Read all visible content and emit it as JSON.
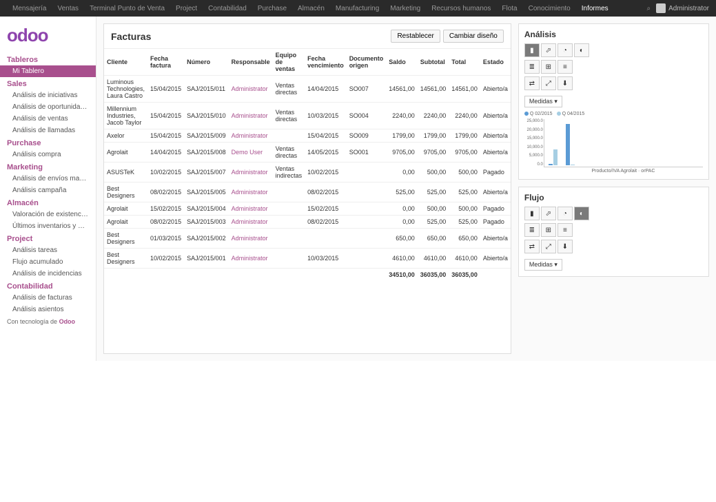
{
  "topnav": {
    "items": [
      "Mensajería",
      "Ventas",
      "Terminal Punto de Venta",
      "Project",
      "Contabilidad",
      "Purchase",
      "Almacén",
      "Manufacturing",
      "Marketing",
      "Recursos humanos",
      "Flota",
      "Conocimiento",
      "Informes"
    ],
    "active_index": 12,
    "search_icon": "⌕",
    "user": "Administrator"
  },
  "logo": "odoo",
  "sidebar": {
    "sections": [
      {
        "title": "Tableros",
        "items": [
          "Mi Tablero"
        ],
        "active_index": 0
      },
      {
        "title": "Sales",
        "items": [
          "Análisis de iniciativas",
          "Análisis de oportunidades",
          "Análisis de ventas",
          "Análisis de llamadas"
        ]
      },
      {
        "title": "Purchase",
        "items": [
          "Análisis compra"
        ]
      },
      {
        "title": "Marketing",
        "items": [
          "Análisis de envíos masivos",
          "Análisis campaña"
        ]
      },
      {
        "title": "Almacén",
        "items": [
          "Valoración de existencias",
          "Últimos inventarios y movi..."
        ]
      },
      {
        "title": "Project",
        "items": [
          "Análisis tareas",
          "Flujo acumulado",
          "Análisis de incidencias"
        ]
      },
      {
        "title": "Contabilidad",
        "items": [
          "Análisis de facturas",
          "Análisis asientos"
        ]
      }
    ]
  },
  "footer_note": {
    "label": "Con tecnología de ",
    "brand": "Odoo"
  },
  "facturas": {
    "title": "Facturas",
    "btn_restablecer": "Restablecer",
    "btn_cambiar": "Cambiar diseño",
    "columns": [
      "Cliente",
      "Fecha factura",
      "Número",
      "Responsable",
      "Equipo de ventas",
      "Fecha vencimiento",
      "Documento origen",
      "Saldo",
      "Subtotal",
      "Total",
      "Estado"
    ],
    "rows": [
      {
        "cliente": "Luminous Technologies, Laura Castro",
        "fecha": "15/04/2015",
        "numero": "SAJ/2015/011",
        "responsable": "Administrator",
        "equipo": "Ventas directas",
        "vencimiento": "14/04/2015",
        "origen": "SO007",
        "saldo": "14561,00",
        "subtotal": "14561,00",
        "total": "14561,00",
        "estado": "Abierto/a"
      },
      {
        "cliente": "Millennium Industries, Jacob Taylor",
        "fecha": "15/04/2015",
        "numero": "SAJ/2015/010",
        "responsable": "Administrator",
        "equipo": "Ventas directas",
        "vencimiento": "10/03/2015",
        "origen": "SO004",
        "saldo": "2240,00",
        "subtotal": "2240,00",
        "total": "2240,00",
        "estado": "Abierto/a"
      },
      {
        "cliente": "Axelor",
        "fecha": "15/04/2015",
        "numero": "SAJ/2015/009",
        "responsable": "Administrator",
        "equipo": "",
        "vencimiento": "15/04/2015",
        "origen": "SO009",
        "saldo": "1799,00",
        "subtotal": "1799,00",
        "total": "1799,00",
        "estado": "Abierto/a"
      },
      {
        "cliente": "Agrolait",
        "fecha": "14/04/2015",
        "numero": "SAJ/2015/008",
        "responsable": "Demo User",
        "equipo": "Ventas directas",
        "vencimiento": "14/05/2015",
        "origen": "SO001",
        "saldo": "9705,00",
        "subtotal": "9705,00",
        "total": "9705,00",
        "estado": "Abierto/a"
      },
      {
        "cliente": "ASUSTeK",
        "fecha": "10/02/2015",
        "numero": "SAJ/2015/007",
        "responsable": "Administrator",
        "equipo": "Ventas indirectas",
        "vencimiento": "10/02/2015",
        "origen": "",
        "saldo": "0,00",
        "subtotal": "500,00",
        "total": "500,00",
        "estado": "Pagado"
      },
      {
        "cliente": "Best Designers",
        "fecha": "08/02/2015",
        "numero": "SAJ/2015/005",
        "responsable": "Administrator",
        "equipo": "",
        "vencimiento": "08/02/2015",
        "origen": "",
        "saldo": "525,00",
        "subtotal": "525,00",
        "total": "525,00",
        "estado": "Abierto/a"
      },
      {
        "cliente": "Agrolait",
        "fecha": "15/02/2015",
        "numero": "SAJ/2015/004",
        "responsable": "Administrator",
        "equipo": "",
        "vencimiento": "15/02/2015",
        "origen": "",
        "saldo": "0,00",
        "subtotal": "500,00",
        "total": "500,00",
        "estado": "Pagado"
      },
      {
        "cliente": "Agrolait",
        "fecha": "08/02/2015",
        "numero": "SAJ/2015/003",
        "responsable": "Administrator",
        "equipo": "",
        "vencimiento": "08/02/2015",
        "origen": "",
        "saldo": "0,00",
        "subtotal": "525,00",
        "total": "525,00",
        "estado": "Pagado"
      },
      {
        "cliente": "Best Designers",
        "fecha": "01/03/2015",
        "numero": "SAJ/2015/002",
        "responsable": "Administrator",
        "equipo": "",
        "vencimiento": "",
        "origen": "",
        "saldo": "650,00",
        "subtotal": "650,00",
        "total": "650,00",
        "estado": "Abierto/a"
      },
      {
        "cliente": "Best Designers",
        "fecha": "10/02/2015",
        "numero": "SAJ/2015/001",
        "responsable": "Administrator",
        "equipo": "",
        "vencimiento": "10/03/2015",
        "origen": "",
        "saldo": "4610,00",
        "subtotal": "4610,00",
        "total": "4610,00",
        "estado": "Abierto/a"
      }
    ],
    "totals": {
      "saldo": "34510,00",
      "subtotal": "36035,00",
      "total": "36035,00"
    }
  },
  "analysis": {
    "title": "Análisis",
    "medidas": "Medidas ▾",
    "legend": [
      {
        "label": "Q 02/2015",
        "color": "#5b9bd5"
      },
      {
        "label": "Q 04/2015",
        "color": "#a6cee3"
      }
    ],
    "yticks": [
      "25,000.0",
      "20,000.0",
      "15,000.0",
      "10,000.0",
      "5,000.0",
      "0.0"
    ],
    "xlabel": "Producto/IVA Agrolait · orPAC"
  },
  "chart_data": {
    "type": "bar",
    "categories": [
      "Producto/IVA Agrolait",
      "orPAC"
    ],
    "series": [
      {
        "name": "Q 02/2015",
        "values": [
          1025,
          25000
        ],
        "color": "#5b9bd5"
      },
      {
        "name": "Q 04/2015",
        "values": [
          9705,
          0
        ],
        "color": "#a6cee3"
      }
    ],
    "ylim": [
      0,
      25000
    ],
    "ylabel": "",
    "xlabel": "Producto/IVA Agrolait · orPAC"
  },
  "flujo": {
    "title": "Flujo",
    "medidas": "Medidas ▾"
  }
}
